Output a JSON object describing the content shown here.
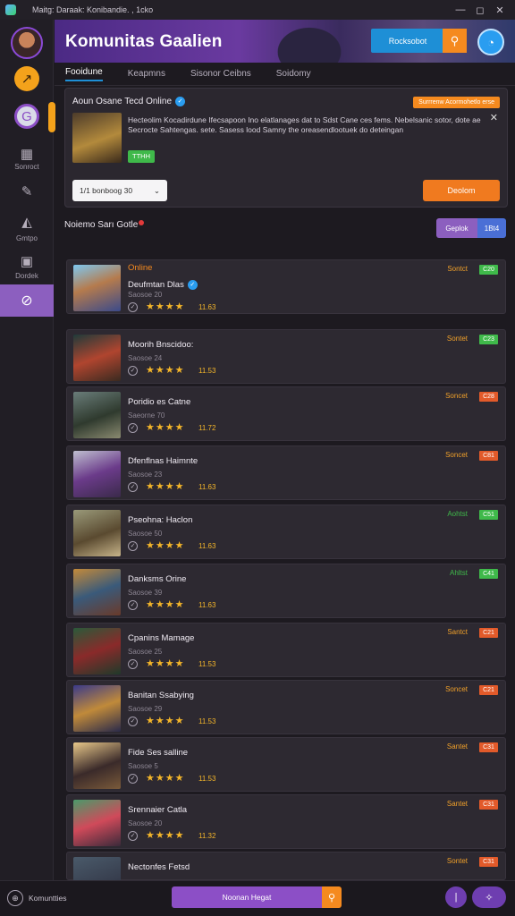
{
  "window": {
    "title": "Maitg: Daraak: Konibandie. , 1cko"
  },
  "hero": {
    "title": "Komunitas Gaalien",
    "button_label": "Rocksobot"
  },
  "tabs": [
    "Fooidune",
    "Keapmns",
    "Sisonor Ceibns",
    "Soidomy"
  ],
  "featured": {
    "title": "Aoun Osane Tecd Online",
    "badge": "Surrrenw Acormohetlo erse",
    "description": "Hecteolim Kocadirdune Ifecsapoon Ino elatlanages dat to Sdst Cane ces fems. Nebelsanic sotor, dote ae Secrocte Sahtengas. sete. Sasess lood Samny the oreasendlootuek do deteingan",
    "tag": "TTHH",
    "select_value": "1/1 bonboog 30",
    "action_label": "Deolom"
  },
  "sidebar": {
    "labels": [
      "Sonroct",
      "Gmtpo",
      "Dordek"
    ]
  },
  "list": {
    "heading": "Noiemo Sarı Gotle",
    "sort_label": "Geplok",
    "count_label": "1Bt4",
    "rows": [
      {
        "extra": "Online",
        "name": "Deufmtan Dlas",
        "sub": "Saosoe 20",
        "rating": "11.63",
        "status": "Sontct",
        "status_color": "#f0a02a",
        "pill": "C20",
        "pill_color": "#3fb94a",
        "thumb": "linear-gradient(160deg,#7ec8f0,#b57b4d 45%,#3b4a8a)",
        "verified": true
      },
      {
        "extra": "",
        "name": "Moorih Bnscidoo:",
        "sub": "Saosoe 24",
        "rating": "11.53",
        "status": "Sontet",
        "status_color": "#f0a02a",
        "pill": "C23",
        "pill_color": "#3fb94a",
        "thumb": "linear-gradient(160deg,#1f3a3a,#b0452f 50%,#3a2a20)",
        "verified": false
      },
      {
        "extra": "",
        "name": "Poridio es Catne",
        "sub": "Saeorne 70",
        "rating": "11.72",
        "status": "Soncet",
        "status_color": "#f0a02a",
        "pill": "C28",
        "pill_color": "#e25a2a",
        "thumb": "linear-gradient(160deg,#6a7d7a,#2f3a2e 55%,#8a8a70)",
        "verified": false
      },
      {
        "extra": "",
        "name": "Dfenflnas Haimnte",
        "sub": "Saosoe 23",
        "rating": "11.63",
        "status": "Soncet",
        "status_color": "#f0a02a",
        "pill": "C81",
        "pill_color": "#e25a2a",
        "thumb": "linear-gradient(160deg,#bfbfd0,#6b3b8a 50%,#3a2a4a)",
        "verified": false
      },
      {
        "extra": "",
        "name": "Pseohna: Haclon",
        "sub": "Saosoe 50",
        "rating": "11.63",
        "status": "Aohtst",
        "status_color": "#3fb94a",
        "pill": "C51",
        "pill_color": "#3fb94a",
        "thumb": "linear-gradient(160deg,#9a9a7a,#5a4a30 55%,#c7b48a)",
        "verified": false
      },
      {
        "extra": "",
        "name": "Danksms Orine",
        "sub": "Saosoe 39",
        "rating": "11.63",
        "status": "Ahltst",
        "status_color": "#3fb94a",
        "pill": "C41",
        "pill_color": "#3fb94a",
        "thumb": "linear-gradient(160deg,#c48a3a,#3a5a7a 50%,#6a3a2a)",
        "verified": false
      },
      {
        "extra": "",
        "name": "Cpanins Mamage",
        "sub": "Saosoe 25",
        "rating": "11.53",
        "status": "Santct",
        "status_color": "#f0a02a",
        "pill": "C21",
        "pill_color": "#e25a2a",
        "thumb": "linear-gradient(160deg,#2a5a3a,#8a2a2a 50%,#1f3a2a)",
        "verified": false
      },
      {
        "extra": "",
        "name": "Banitan Ssabying",
        "sub": "Saosoe 29",
        "rating": "11.53",
        "status": "Soncet",
        "status_color": "#f0a02a",
        "pill": "C21",
        "pill_color": "#e25a2a",
        "thumb": "linear-gradient(160deg,#3a3a8a,#c08a3a 50%,#2a2a4a)",
        "verified": false
      },
      {
        "extra": "",
        "name": "Fide Ses salline",
        "sub": "Saosoe 5",
        "rating": "11.53",
        "status": "Santet",
        "status_color": "#f0a02a",
        "pill": "C31",
        "pill_color": "#e25a2a",
        "thumb": "linear-gradient(160deg,#e8c88a,#3a2a2a 55%,#7a5a3a)",
        "verified": false
      },
      {
        "extra": "",
        "name": "Srennaier Catla",
        "sub": "Saosoe 20",
        "rating": "11.32",
        "status": "Santet",
        "status_color": "#f0a02a",
        "pill": "C31",
        "pill_color": "#e25a2a",
        "thumb": "linear-gradient(160deg,#4a9a6a,#d04a5a 50%,#3a2a3a)",
        "verified": false
      },
      {
        "extra": "",
        "name": "Nectonfes Fetsd",
        "sub": "",
        "rating": "",
        "status": "Sontet",
        "status_color": "#f0a02a",
        "pill": "C31",
        "pill_color": "#e25a2a",
        "thumb": "linear-gradient(160deg,#4a5a6a,#2a2a3a)",
        "verified": false
      }
    ]
  },
  "bottom": {
    "label": "Komuntties",
    "button_label": "Noonan Hegat"
  }
}
